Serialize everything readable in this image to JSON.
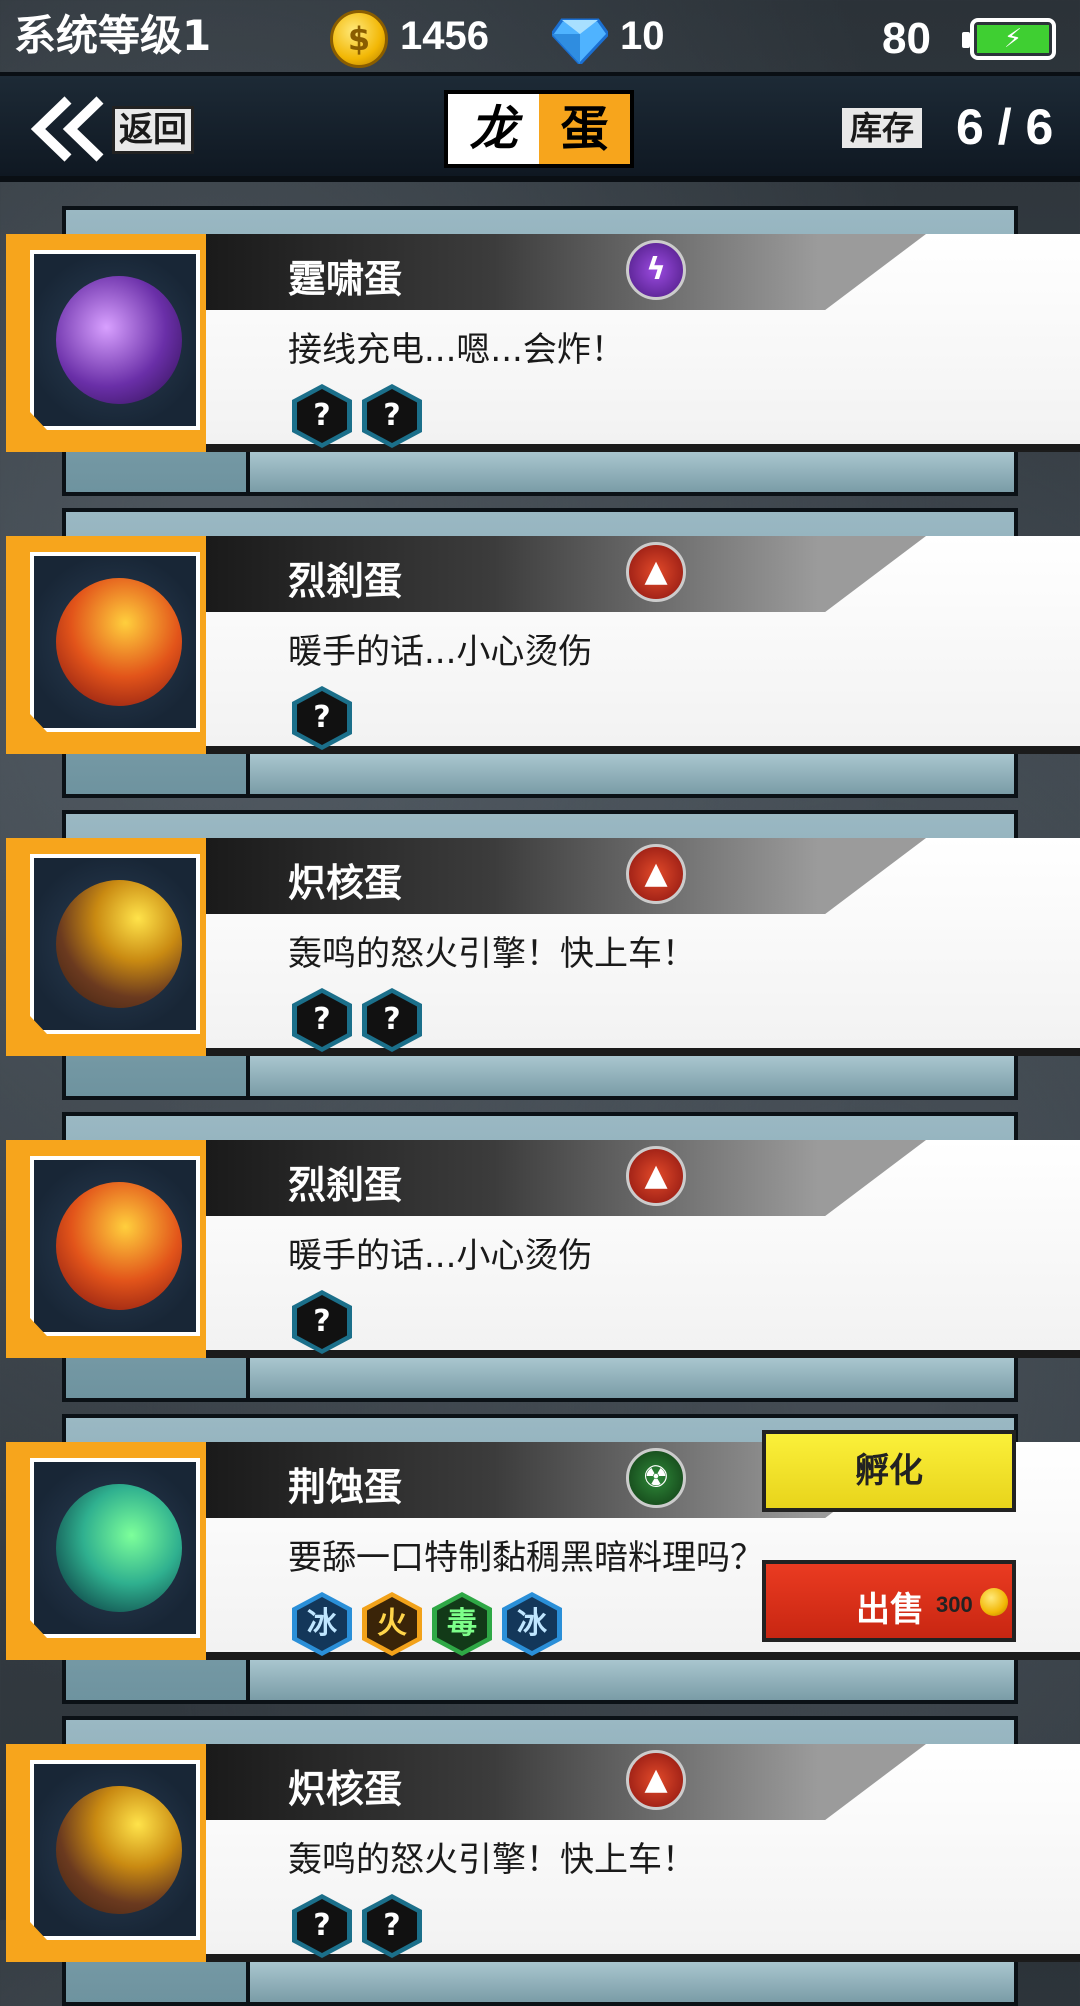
{
  "status": {
    "level_label": "系统等级1",
    "coins": "1456",
    "gems": "10",
    "battery": "80"
  },
  "header": {
    "back_label": "返回",
    "title_left": "龙",
    "title_right": "蛋",
    "stock_label": "库存",
    "stock_value": "6 / 6"
  },
  "eggs": [
    {
      "name": "霆啸蛋",
      "desc": "接线充电...嗯...会炸！",
      "element": "lightning-icon",
      "badges": [
        "?",
        "?"
      ]
    },
    {
      "name": "烈刹蛋",
      "desc": "暖手的话...小心烫伤",
      "element": "fire-icon",
      "badges": [
        "?"
      ]
    },
    {
      "name": "炽核蛋",
      "desc": "轰鸣的怒火引擎！快上车！",
      "element": "fire-icon",
      "badges": [
        "?",
        "?"
      ]
    },
    {
      "name": "烈刹蛋",
      "desc": "暖手的话...小心烫伤",
      "element": "fire-icon",
      "badges": [
        "?"
      ]
    },
    {
      "name": "荆蚀蛋",
      "desc": "要舔一口特制黏稠黑暗料理吗？",
      "element": "poison-icon",
      "badges": [
        "冰",
        "火",
        "毒",
        "冰"
      ]
    },
    {
      "name": "炽核蛋",
      "desc": "轰鸣的怒火引擎！快上车！",
      "element": "fire-icon",
      "badges": [
        "?",
        "?"
      ]
    }
  ],
  "actions": {
    "hatch_label": "孵化",
    "sell_label": "出售",
    "sell_price": "300"
  }
}
